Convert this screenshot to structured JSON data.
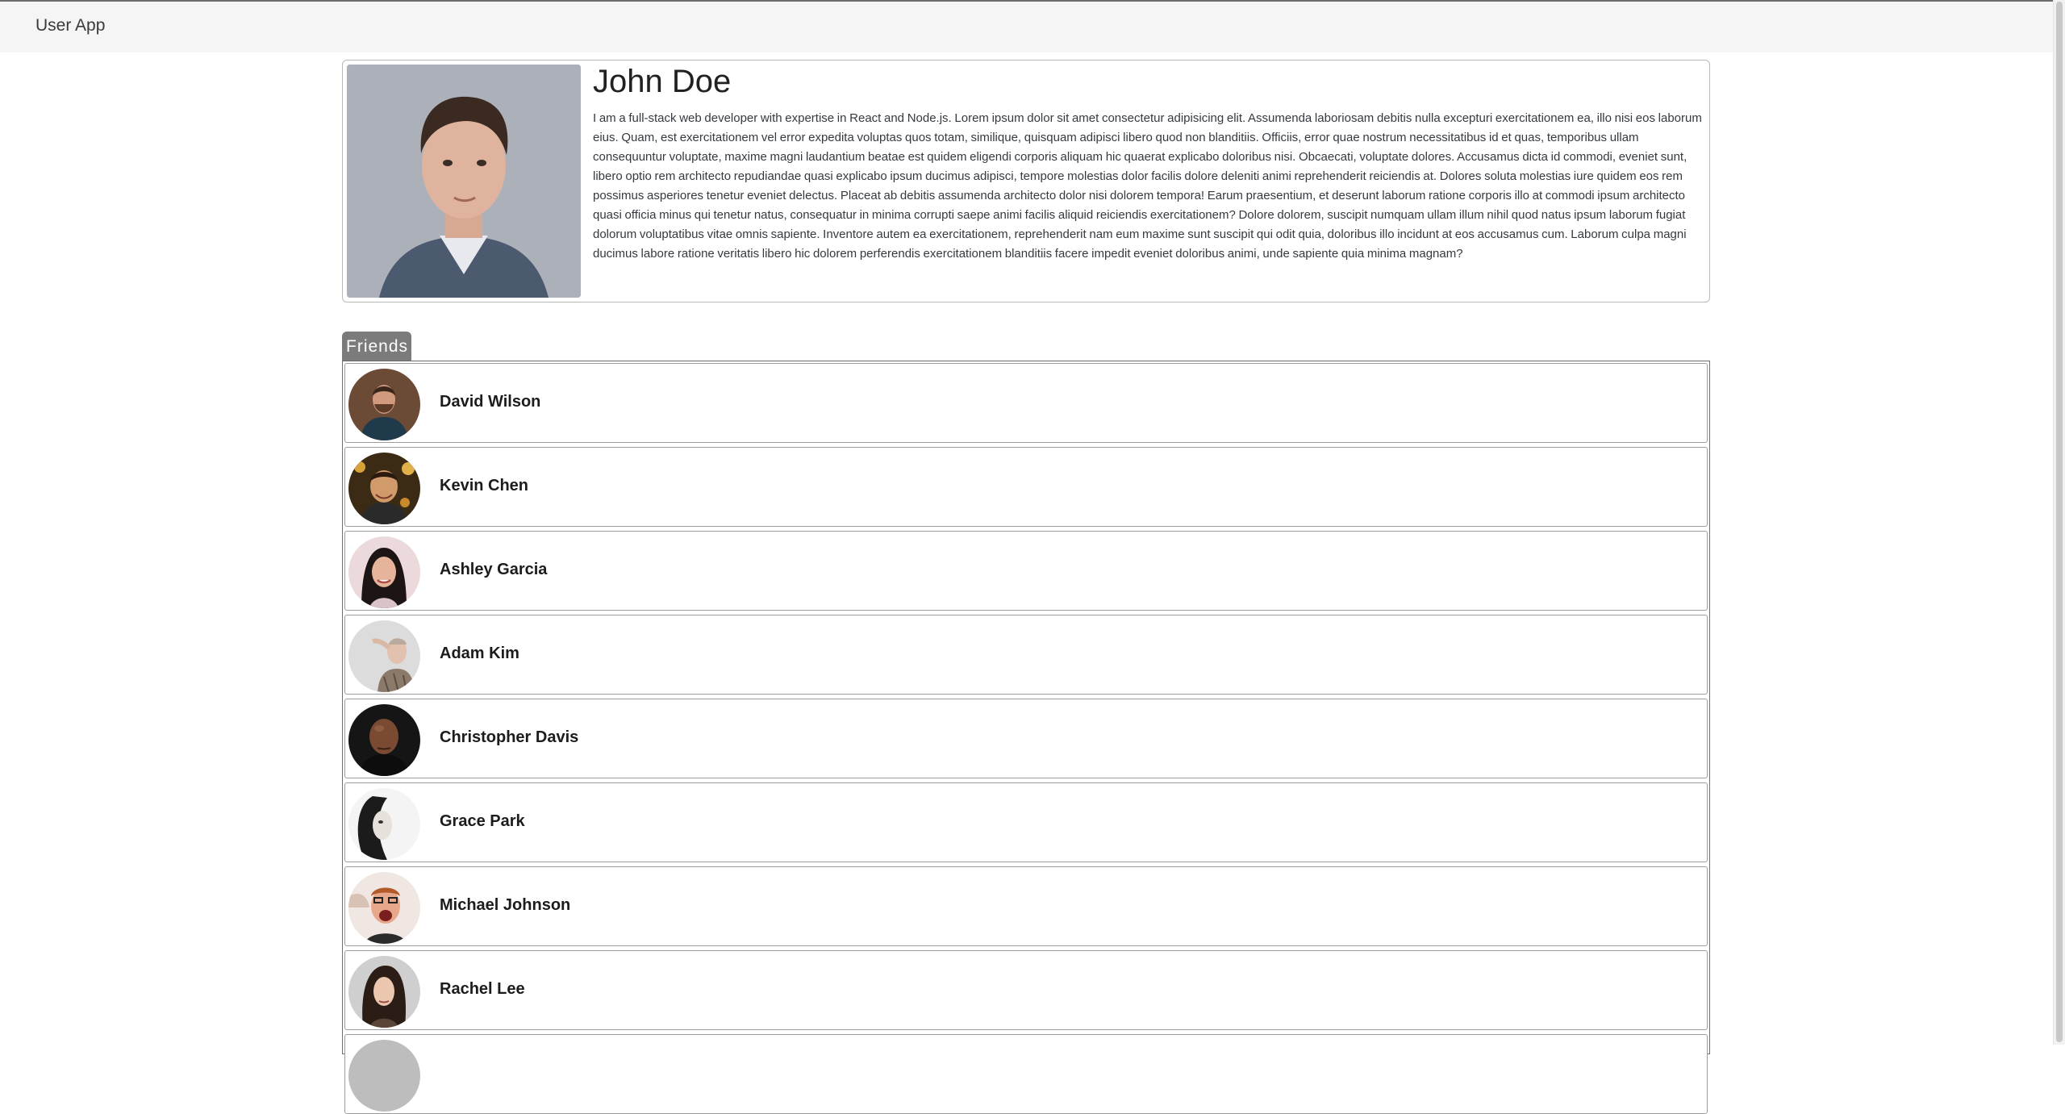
{
  "app": {
    "brand": "User App"
  },
  "profile": {
    "name": "John Doe",
    "bio": "I am a full-stack web developer with expertise in React and Node.js. Lorem ipsum dolor sit amet consectetur adipisicing elit. Assumenda laboriosam debitis nulla excepturi exercitationem ea, illo nisi eos laborum eius. Quam, est exercitationem vel error expedita voluptas quos totam, similique, quisquam adipisci libero quod non blanditiis. Officiis, error quae nostrum necessitatibus id et quas, temporibus ullam consequuntur voluptate, maxime magni laudantium beatae est quidem eligendi corporis aliquam hic quaerat explicabo doloribus nisi. Obcaecati, voluptate dolores. Accusamus dicta id commodi, eveniet sunt, libero optio rem architecto repudiandae quasi explicabo ipsum ducimus adipisci, tempore molestias dolor facilis dolore deleniti animi reprehenderit reiciendis at. Dolores soluta molestias iure quidem eos rem possimus asperiores tenetur eveniet delectus. Placeat ab debitis assumenda architecto dolor nisi dolorem tempora! Earum praesentium, et deserunt laborum ratione corporis illo at commodi ipsum architecto quasi officia minus qui tenetur natus, consequatur in minima corrupti saepe animi facilis aliquid reiciendis exercitationem? Dolore dolorem, suscipit numquam ullam illum nihil quod natus ipsum laborum fugiat dolorum voluptatibus vitae omnis sapiente. Inventore autem ea exercitationem, reprehenderit nam eum maxime sunt suscipit qui odit quia, doloribus illo incidunt at eos accusamus cum. Laborum culpa magni ducimus labore ratione veritatis libero hic dolorem perferendis exercitationem blanditiis facere impedit eveniet doloribus animi, unde sapiente quia minima magnam?"
  },
  "friends": {
    "tab_label": "Friends",
    "items": [
      {
        "name": "David Wilson"
      },
      {
        "name": "Kevin Chen"
      },
      {
        "name": "Ashley Garcia"
      },
      {
        "name": "Adam Kim"
      },
      {
        "name": "Christopher Davis"
      },
      {
        "name": "Grace Park"
      },
      {
        "name": "Michael Johnson"
      },
      {
        "name": "Rachel Lee"
      },
      {
        "name": ""
      }
    ]
  }
}
